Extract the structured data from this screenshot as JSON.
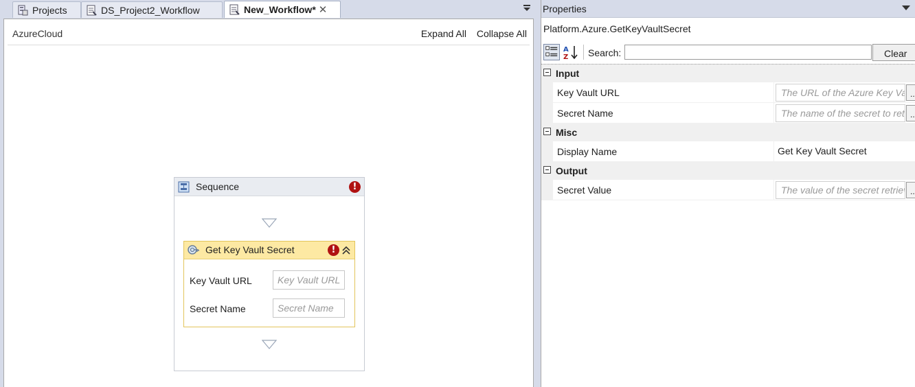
{
  "tabs": [
    {
      "label": "Projects",
      "icon": "projects-icon"
    },
    {
      "label": "DS_Project2_Workflow",
      "icon": "workflow-doc-icon"
    },
    {
      "label": "New_Workflow*",
      "icon": "workflow-doc-icon",
      "active": true
    }
  ],
  "designer": {
    "breadcrumb": "AzureCloud",
    "expand_all": "Expand All",
    "collapse_all": "Collapse All",
    "sequence": {
      "title": "Sequence",
      "error_glyph": "!",
      "activity": {
        "title": "Get Key Vault Secret",
        "error_glyph": "!",
        "fields": [
          {
            "label": "Key Vault URL",
            "placeholder": "Key Vault URL"
          },
          {
            "label": "Secret Name",
            "placeholder": "Secret Name"
          }
        ]
      }
    }
  },
  "properties": {
    "title": "Properties",
    "type_name": "Platform.Azure.GetKeyVaultSecret",
    "search_label": "Search:",
    "search_value": "",
    "clear_label": "Clear",
    "categories": [
      {
        "name": "Input",
        "rows": [
          {
            "name": "Key Vault URL",
            "placeholder": "The URL of the Azure Key Vault",
            "ellipsis": "..."
          },
          {
            "name": "Secret Name",
            "placeholder": "The name of the secret to retrieve",
            "ellipsis": "..."
          }
        ]
      },
      {
        "name": "Misc",
        "rows": [
          {
            "name": "Display Name",
            "value": "Get Key Vault Secret"
          }
        ]
      },
      {
        "name": "Output",
        "rows": [
          {
            "name": "Secret Value",
            "placeholder": "The value of the secret retrieved",
            "ellipsis": "..."
          }
        ]
      }
    ]
  },
  "colors": {
    "chrome_bg": "#d6dbe9",
    "activity_header": "#fde9a3",
    "error_red": "#b01212"
  }
}
